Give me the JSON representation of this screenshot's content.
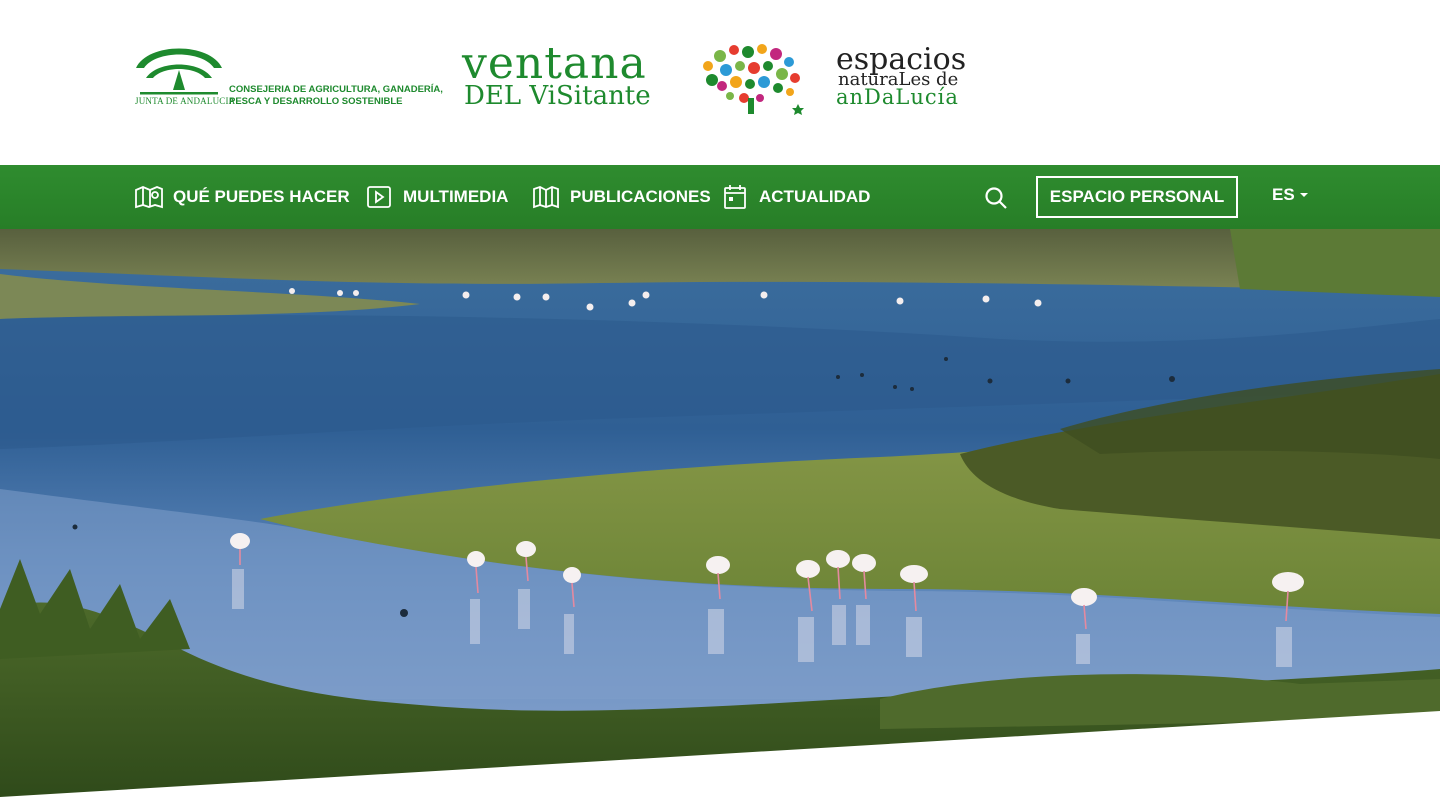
{
  "header": {
    "junta": {
      "name": "JUNTA DE ANDALUCIA",
      "department_line1": "CONSEJERIA DE AGRICULTURA, GANADERÍA,",
      "department_line2": "PESCA Y DESARROLLO SOSTENIBLE"
    },
    "ventana": {
      "line1": "ventana",
      "line2": "DEL ViSitante"
    },
    "espacios": {
      "line1": "espacios",
      "line2": "naturaLes de",
      "line3": "anDaLucía"
    }
  },
  "nav": {
    "items": [
      {
        "label": "QUÉ PUEDES HACER",
        "icon": "map-pin-icon"
      },
      {
        "label": "MULTIMEDIA",
        "icon": "play-icon"
      },
      {
        "label": "PUBLICACIONES",
        "icon": "book-icon"
      },
      {
        "label": "ACTUALIDAD",
        "icon": "calendar-icon"
      }
    ],
    "search_icon": "search-icon",
    "personal_label": "ESPACIO PERSONAL",
    "language": "ES"
  },
  "hero": {
    "image": "flamingos-wetland-photo"
  },
  "colors": {
    "brand_green": "#2e8b2e",
    "logo_green": "#1e8a2e",
    "white": "#ffffff"
  }
}
